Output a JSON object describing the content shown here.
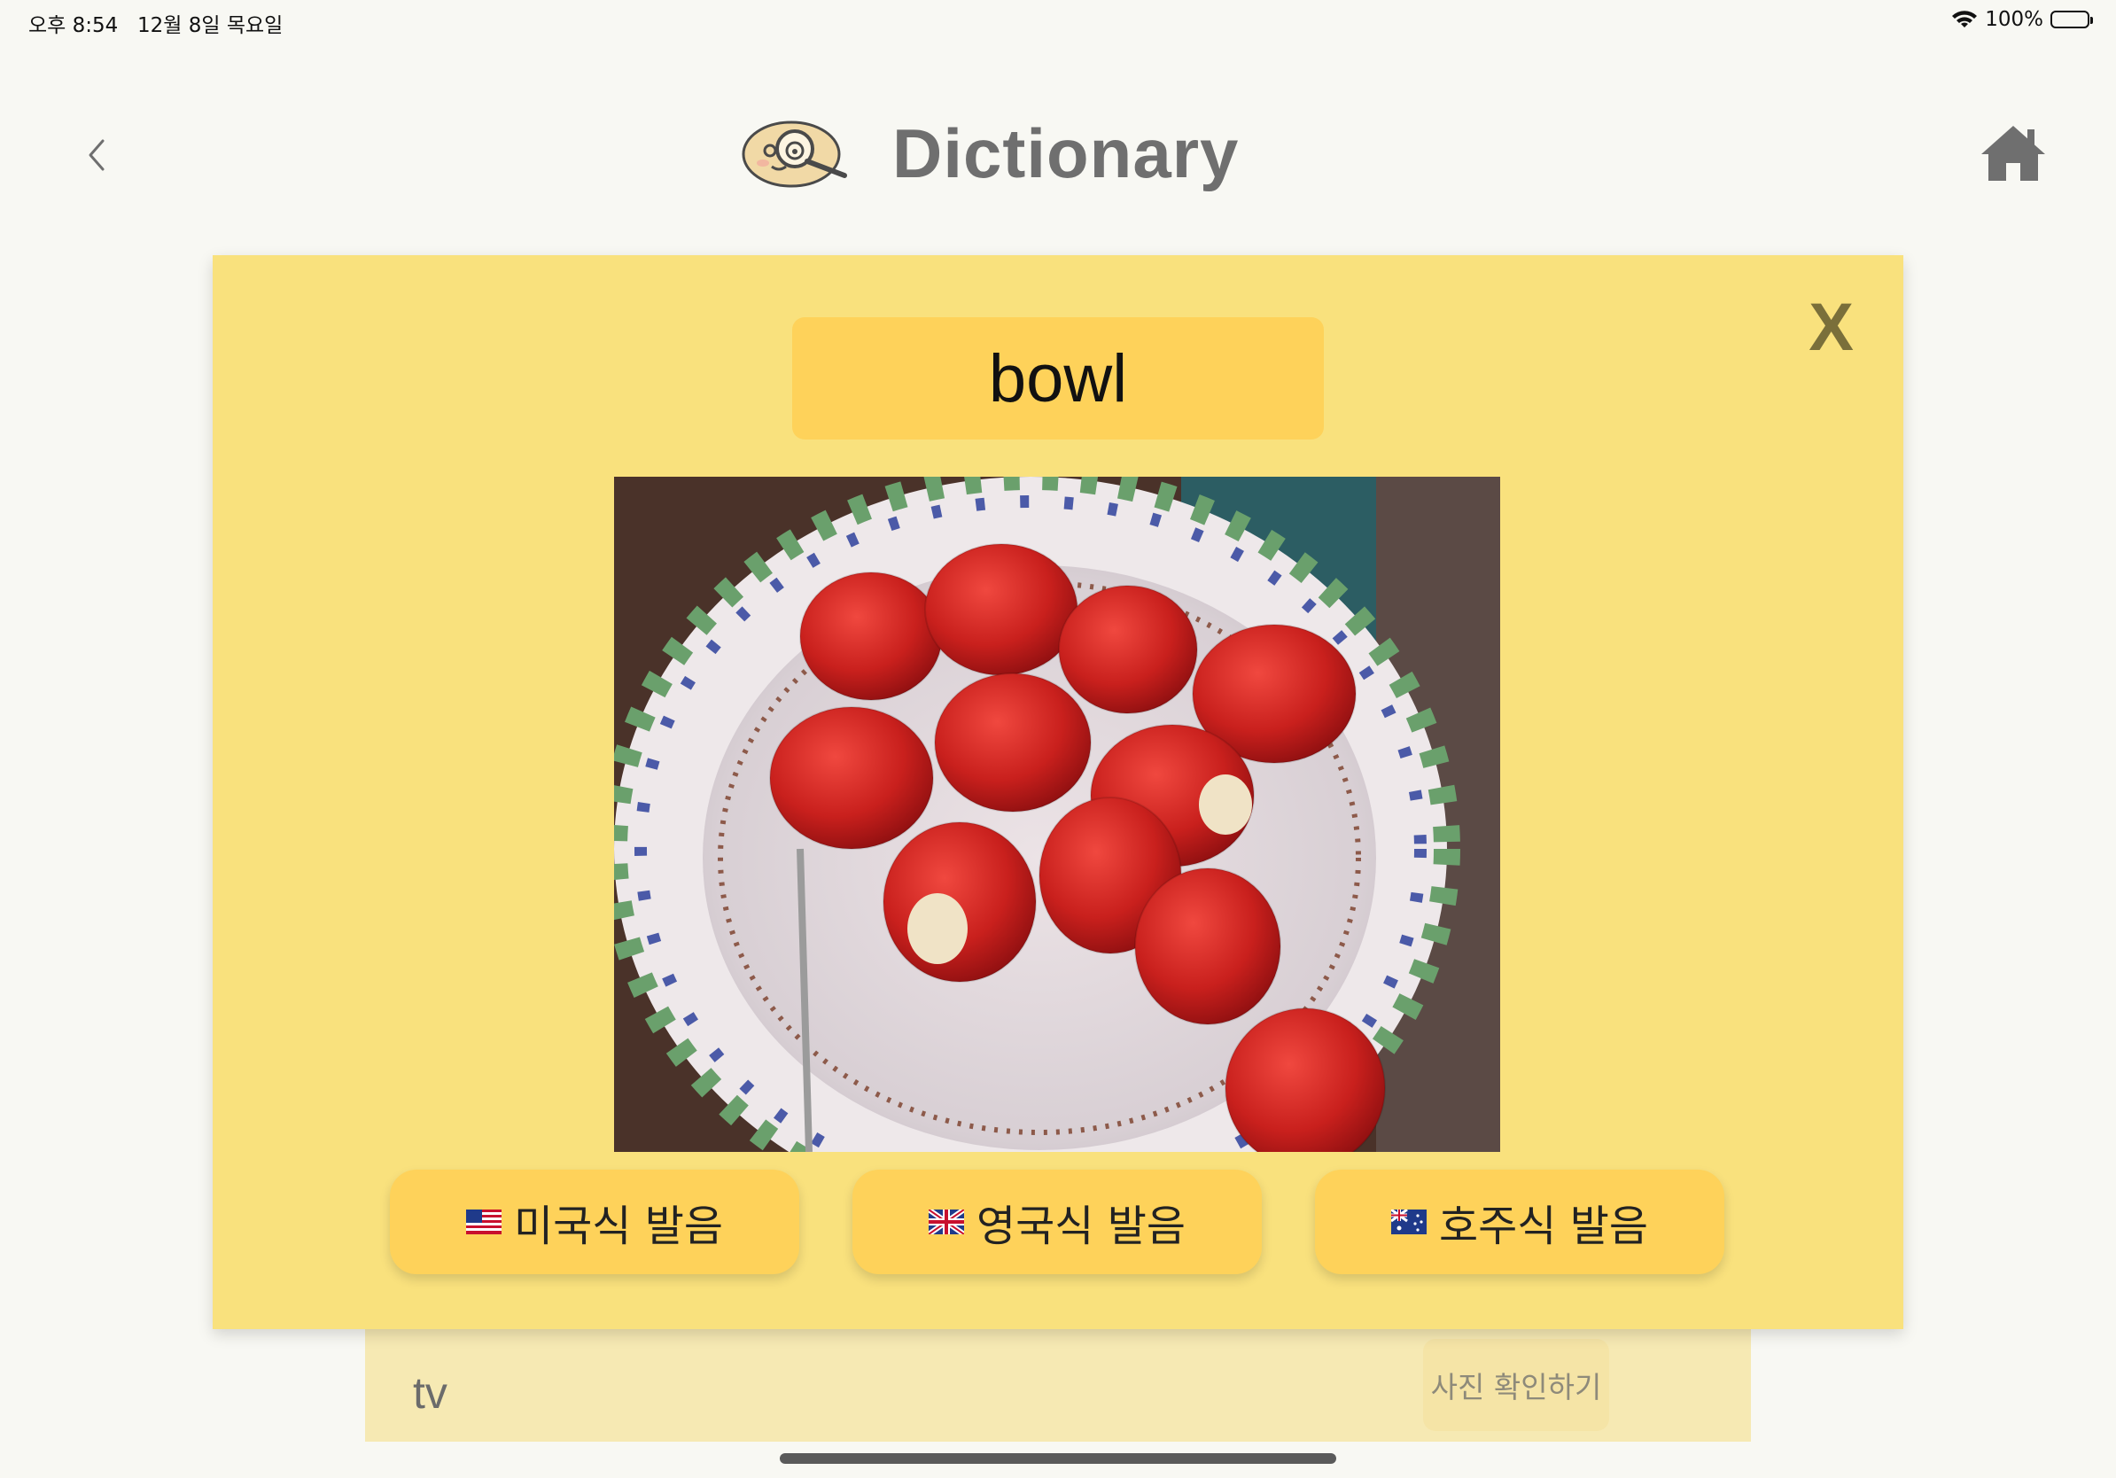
{
  "status_bar": {
    "time": "오후 8:54",
    "date": "12월 8일 목요일",
    "battery_percent": "100%"
  },
  "header": {
    "title": "Dictionary",
    "back_icon": "chevron-left-icon",
    "home_icon": "home-icon",
    "logo_icon": "magnifier-face-logo"
  },
  "modal": {
    "close_label": "X",
    "word": "bowl",
    "image": "photo-of-strawberries-in-bowl",
    "pronunciation_buttons": [
      {
        "flag": "us-flag-icon",
        "label": "미국식 발음"
      },
      {
        "flag": "uk-flag-icon",
        "label": "영국식 발음"
      },
      {
        "flag": "au-flag-icon",
        "label": "호주식 발음"
      }
    ]
  },
  "list": {
    "rows": [
      {
        "word": "tv",
        "action_label": "사진 확인하기"
      }
    ]
  },
  "colors": {
    "modal_bg": "#f9e17d",
    "button_bg": "#fed25a",
    "page_bg": "#f8f8f3"
  }
}
